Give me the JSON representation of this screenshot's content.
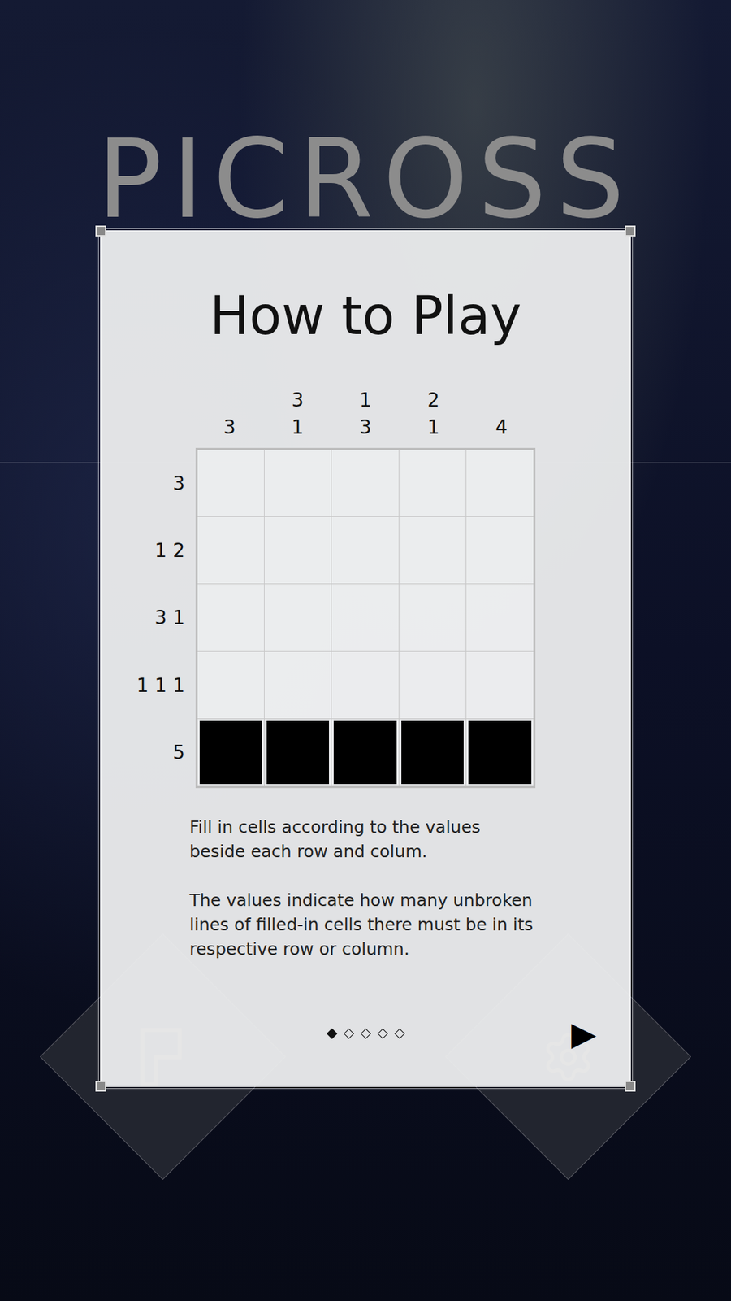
{
  "title": "PICROSS",
  "dialog": {
    "heading": "How to Play",
    "puzzle": {
      "column_clues": [
        [
          "3"
        ],
        [
          "3",
          "1"
        ],
        [
          "1",
          "3"
        ],
        [
          "2",
          "1"
        ],
        [
          "4"
        ]
      ],
      "row_clues": [
        "3",
        "1 2",
        "3 1",
        "1 1 1",
        "5"
      ],
      "cells": [
        [
          false,
          false,
          false,
          false,
          false
        ],
        [
          false,
          false,
          false,
          false,
          false
        ],
        [
          false,
          false,
          false,
          false,
          false
        ],
        [
          false,
          false,
          false,
          false,
          false
        ],
        [
          true,
          true,
          true,
          true,
          true
        ]
      ]
    },
    "paragraphs": [
      "Fill in cells according to the values beside each row and colum.",
      "The values indicate how many unbroken lines of filled-in cells there must be in its respective row or column."
    ],
    "pages": [
      {
        "selected": true
      },
      {
        "selected": false
      },
      {
        "selected": false
      },
      {
        "selected": false
      },
      {
        "selected": false
      }
    ],
    "next_button": "▶"
  }
}
